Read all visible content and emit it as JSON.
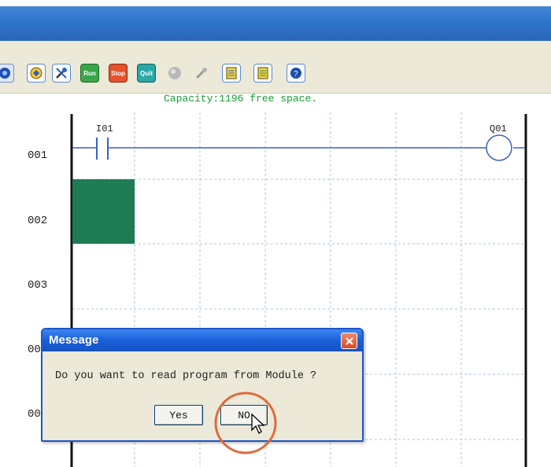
{
  "toolbar": {
    "buttons": [
      {
        "icon": "blue-circle-icon",
        "label": ""
      },
      {
        "icon": "read-module-icon",
        "label": ""
      },
      {
        "icon": "tools-icon",
        "label": ""
      },
      {
        "icon": "run-icon",
        "label": "Run"
      },
      {
        "icon": "stop-icon",
        "label": "Stop"
      },
      {
        "icon": "quit-icon",
        "label": "Quit"
      },
      {
        "icon": "gray-circle-icon",
        "label": ""
      },
      {
        "icon": "gray-tool-icon",
        "label": ""
      },
      {
        "icon": "yellow-doc-icon",
        "label": ""
      },
      {
        "icon": "green-doc-icon",
        "label": ""
      },
      {
        "icon": "help-icon",
        "label": ""
      }
    ]
  },
  "status": {
    "capacity_prefix": "Capacity:",
    "capacity_value": "1196",
    "capacity_suffix": " free space."
  },
  "ladder": {
    "rows": [
      "001",
      "002",
      "003",
      "00",
      "00"
    ],
    "contact_label": "I01",
    "coil_label": "Q01",
    "colors": {
      "selection": "#1e7b54",
      "grid": "#a9c4e2",
      "rung": "#3a62c4"
    }
  },
  "dialog": {
    "title": "Message",
    "message": "Do you want to read program from Module ?",
    "yes_label": "Yes",
    "no_label": "NO"
  }
}
